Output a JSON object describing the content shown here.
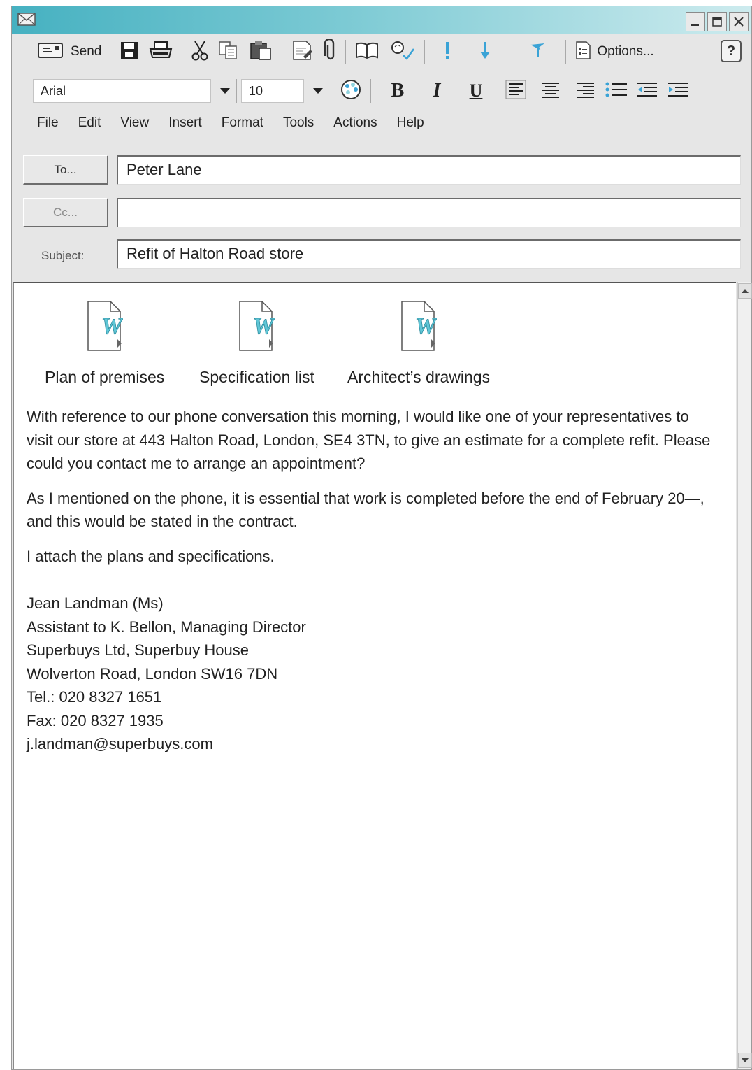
{
  "window": {
    "icon": "envelope-icon",
    "controls": [
      "minimize-icon",
      "maximize-icon",
      "close-icon"
    ]
  },
  "toolbar": {
    "send_label": "Send",
    "options_label": "Options...",
    "help_label": "?"
  },
  "format_bar": {
    "font": "Arial",
    "size": "10",
    "bold": "B",
    "italic": "I",
    "underline": "U"
  },
  "menu": [
    "File",
    "Edit",
    "View",
    "Insert",
    "Format",
    "Tools",
    "Actions",
    "Help"
  ],
  "header": {
    "to_button": "To...",
    "cc_button": "Cc...",
    "subject_label": "Subject:",
    "to_value": "Peter Lane",
    "cc_value": "",
    "subject_value": "Refit of Halton Road store"
  },
  "attachments": [
    {
      "label": "Plan of premises",
      "icon": "word-document-icon"
    },
    {
      "label": "Specification list",
      "icon": "word-document-icon"
    },
    {
      "label": "Architect’s drawings",
      "icon": "word-document-icon"
    }
  ],
  "message": {
    "paragraphs": [
      "With reference to our phone conversation this morning, I would like one of your representatives to visit our store at 443 Halton Road, London, SE4 3TN, to give an estimate for a complete refit. Please could you contact me to arrange an appointment?",
      "As I mentioned on the phone, it is essential that work is completed before the end of February 20—, and this would be stated in the contract.",
      "I attach the plans and specifications."
    ],
    "signature": [
      "Jean Landman (Ms)",
      "Assistant to K. Bellon, Managing Director",
      "Superbuys Ltd, Superbuy House",
      "Wolverton Road, London SW16 7DN",
      "Tel.: 020 8327 1651",
      "Fax: 020 8327 1935",
      "j.landman@superbuys.com"
    ]
  },
  "colors": {
    "titlebar_start": "#46b1c1",
    "titlebar_end": "#cdebee",
    "accent_blue": "#3aa3d6",
    "word_icon": "#5fc6d6"
  }
}
